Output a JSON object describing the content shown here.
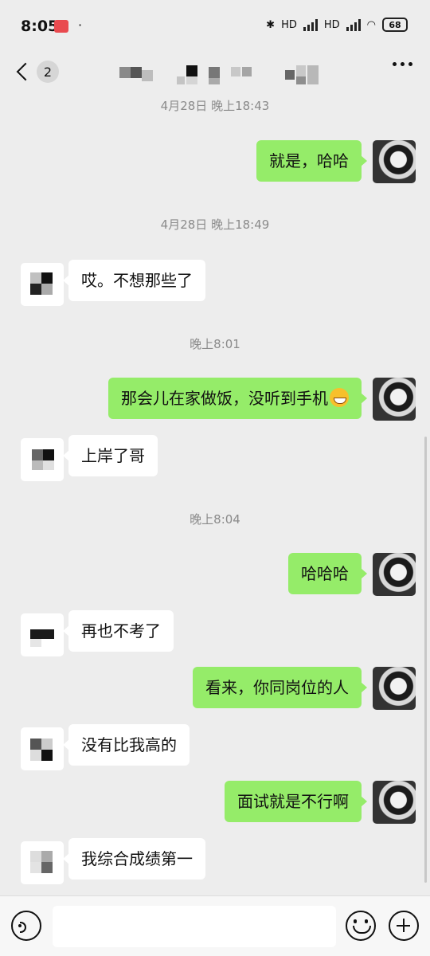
{
  "status_bar": {
    "time": "8:05",
    "dot": "·",
    "network_1": "HD",
    "network_2": "HD",
    "battery": "68"
  },
  "header": {
    "unread_count": "2"
  },
  "messages": [
    {
      "type": "timestamp",
      "text": "4月28日 晚上18:43"
    },
    {
      "type": "sent",
      "text": "就是，哈哈"
    },
    {
      "type": "timestamp",
      "text": "4月28日 晚上18:49"
    },
    {
      "type": "received",
      "text": "哎。不想那些了"
    },
    {
      "type": "timestamp",
      "text": "晚上8:01"
    },
    {
      "type": "sent",
      "text": "那会儿在家做饭，没听到手机",
      "emoji": "grinning-face"
    },
    {
      "type": "received",
      "text": "上岸了哥"
    },
    {
      "type": "timestamp",
      "text": "晚上8:04"
    },
    {
      "type": "sent",
      "text": "哈哈哈"
    },
    {
      "type": "received",
      "text": "再也不考了"
    },
    {
      "type": "sent",
      "text": "看来，你同岗位的人"
    },
    {
      "type": "received",
      "text": "没有比我高的"
    },
    {
      "type": "sent",
      "text": "面试就是不行啊"
    },
    {
      "type": "received",
      "text": "我综合成绩第一"
    }
  ],
  "input": {
    "placeholder": ""
  },
  "colors": {
    "sent_bubble": "#95ec69",
    "received_bubble": "#ffffff",
    "background": "#ededed"
  }
}
